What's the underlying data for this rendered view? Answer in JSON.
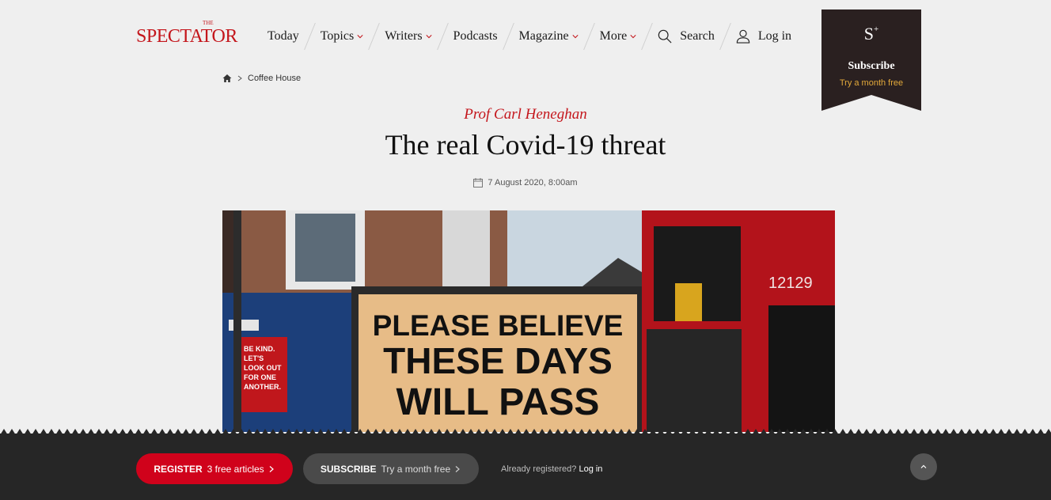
{
  "header": {
    "logo": "SPECTATOR",
    "logo_the": "THE",
    "nav": [
      {
        "label": "Today",
        "dropdown": false
      },
      {
        "label": "Topics",
        "dropdown": true
      },
      {
        "label": "Writers",
        "dropdown": true
      },
      {
        "label": "Podcasts",
        "dropdown": false
      },
      {
        "label": "Magazine",
        "dropdown": true
      },
      {
        "label": "More",
        "dropdown": true
      }
    ],
    "search_label": "Search",
    "login_label": "Log in",
    "subscribe": {
      "symbol": "S",
      "plus": "+",
      "label": "Subscribe",
      "trial": "Try a month free"
    }
  },
  "breadcrumb": {
    "section": "Coffee House"
  },
  "article": {
    "author": "Prof Carl Heneghan",
    "title": "The real Covid-19 threat",
    "date": "7 August 2020, 8:00am",
    "image_texts": {
      "billboard": [
        "PLEASE BELIEVE",
        "THESE DAYS",
        "WILL PASS"
      ],
      "bus_number": "12129",
      "poster": [
        "BE KIND.",
        "LET'S",
        "LOOK OUT",
        "FOR ONE",
        "ANOTHER."
      ]
    }
  },
  "footer": {
    "register_label": "REGISTER",
    "register_sub": "3 free articles",
    "subscribe_label": "SUBSCRIBE",
    "subscribe_sub": "Try a month free",
    "already_text": "Already registered?",
    "login_link": "Log in"
  },
  "colors": {
    "brand_red": "#c4161c",
    "ribbon": "#2a2020",
    "bar": "#262626",
    "register_btn": "#d0021b",
    "trial_gold": "#e3a93a"
  }
}
